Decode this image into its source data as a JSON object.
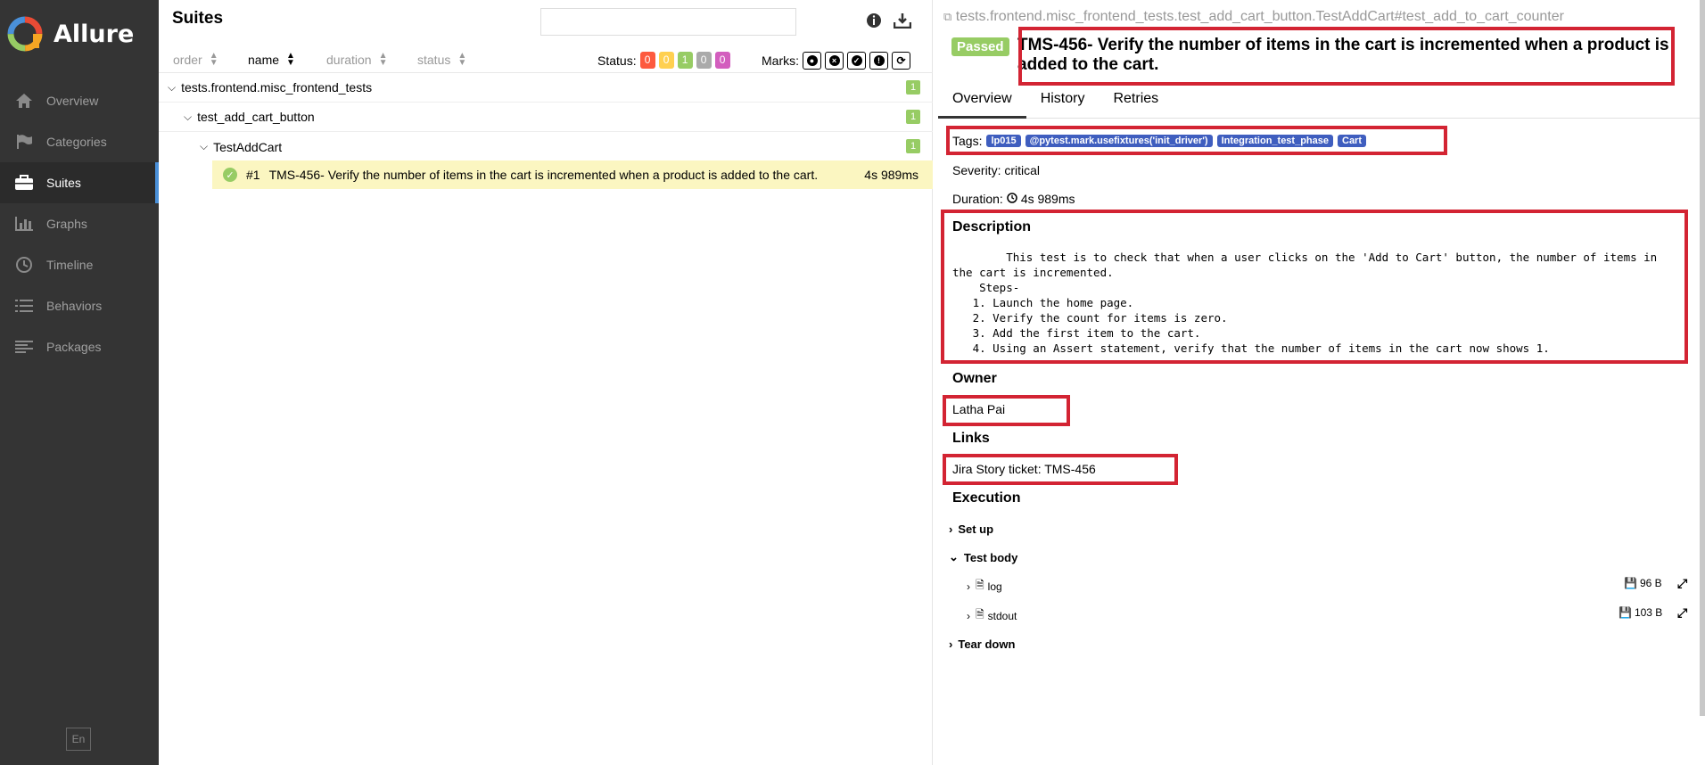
{
  "app": {
    "name": "Allure"
  },
  "sidebar": {
    "items": [
      {
        "label": "Overview",
        "icon": "home-icon"
      },
      {
        "label": "Categories",
        "icon": "flag-icon"
      },
      {
        "label": "Suites",
        "icon": "briefcase-icon",
        "active": true
      },
      {
        "label": "Graphs",
        "icon": "bar-chart-icon"
      },
      {
        "label": "Timeline",
        "icon": "clock-icon"
      },
      {
        "label": "Behaviors",
        "icon": "list-icon"
      },
      {
        "label": "Packages",
        "icon": "align-left-icon"
      }
    ],
    "language": "En"
  },
  "suites": {
    "title": "Suites",
    "search": {
      "value": "",
      "placeholder": ""
    },
    "sort": {
      "order": "order",
      "name": "name",
      "duration": "duration",
      "status": "status"
    },
    "status_label": "Status:",
    "status_counts": [
      {
        "value": "0",
        "color": "#fd5a3e"
      },
      {
        "value": "0",
        "color": "#ffd050"
      },
      {
        "value": "1",
        "color": "#97cc64"
      },
      {
        "value": "0",
        "color": "#aaaaaa"
      },
      {
        "value": "0",
        "color": "#d35ebe"
      }
    ],
    "marks_label": "Marks:",
    "tree": [
      {
        "label": "tests.frontend.misc_frontend_tests",
        "count": "1"
      },
      {
        "label": "test_add_cart_button",
        "count": "1"
      },
      {
        "label": "TestAddCart",
        "count": "1"
      }
    ],
    "test": {
      "order": "#1",
      "name": "TMS-456- Verify the number of items in the cart is incremented when a product is added to the cart.",
      "duration": "4s 989ms"
    }
  },
  "detail": {
    "fullname": "tests.frontend.misc_frontend_tests.test_add_cart_button.TestAddCart#test_add_to_cart_counter",
    "status": "Passed",
    "title": "TMS-456- Verify the number of items in the cart is incremented when a product is added to the cart.",
    "tabs": [
      "Overview",
      "History",
      "Retries"
    ],
    "tags_label": "Tags:",
    "tags": [
      "lp015",
      "@pytest.mark.usefixtures('init_driver')",
      "Integration_test_phase",
      "Cart"
    ],
    "severity": "Severity: critical",
    "duration_label": "Duration:",
    "duration": "4s 989ms",
    "description_heading": "Description",
    "description": "        This test is to check that when a user clicks on the 'Add to Cart' button, the number of items in\nthe cart is incremented.\n    Steps-\n   1. Launch the home page.\n   2. Verify the count for items is zero.\n   3. Add the first item to the cart.\n   4. Using an Assert statement, verify that the number of items in the cart now shows 1.",
    "owner_heading": "Owner",
    "owner": "Latha Pai",
    "links_heading": "Links",
    "link": "Jira Story ticket: TMS-456",
    "execution_heading": "Execution",
    "execution": {
      "setup": "Set up",
      "body": "Test body",
      "attachments": [
        {
          "name": "log",
          "size": "96 B"
        },
        {
          "name": "stdout",
          "size": "103 B"
        }
      ],
      "teardown": "Tear down"
    },
    "annotation_color": "#d32433"
  }
}
